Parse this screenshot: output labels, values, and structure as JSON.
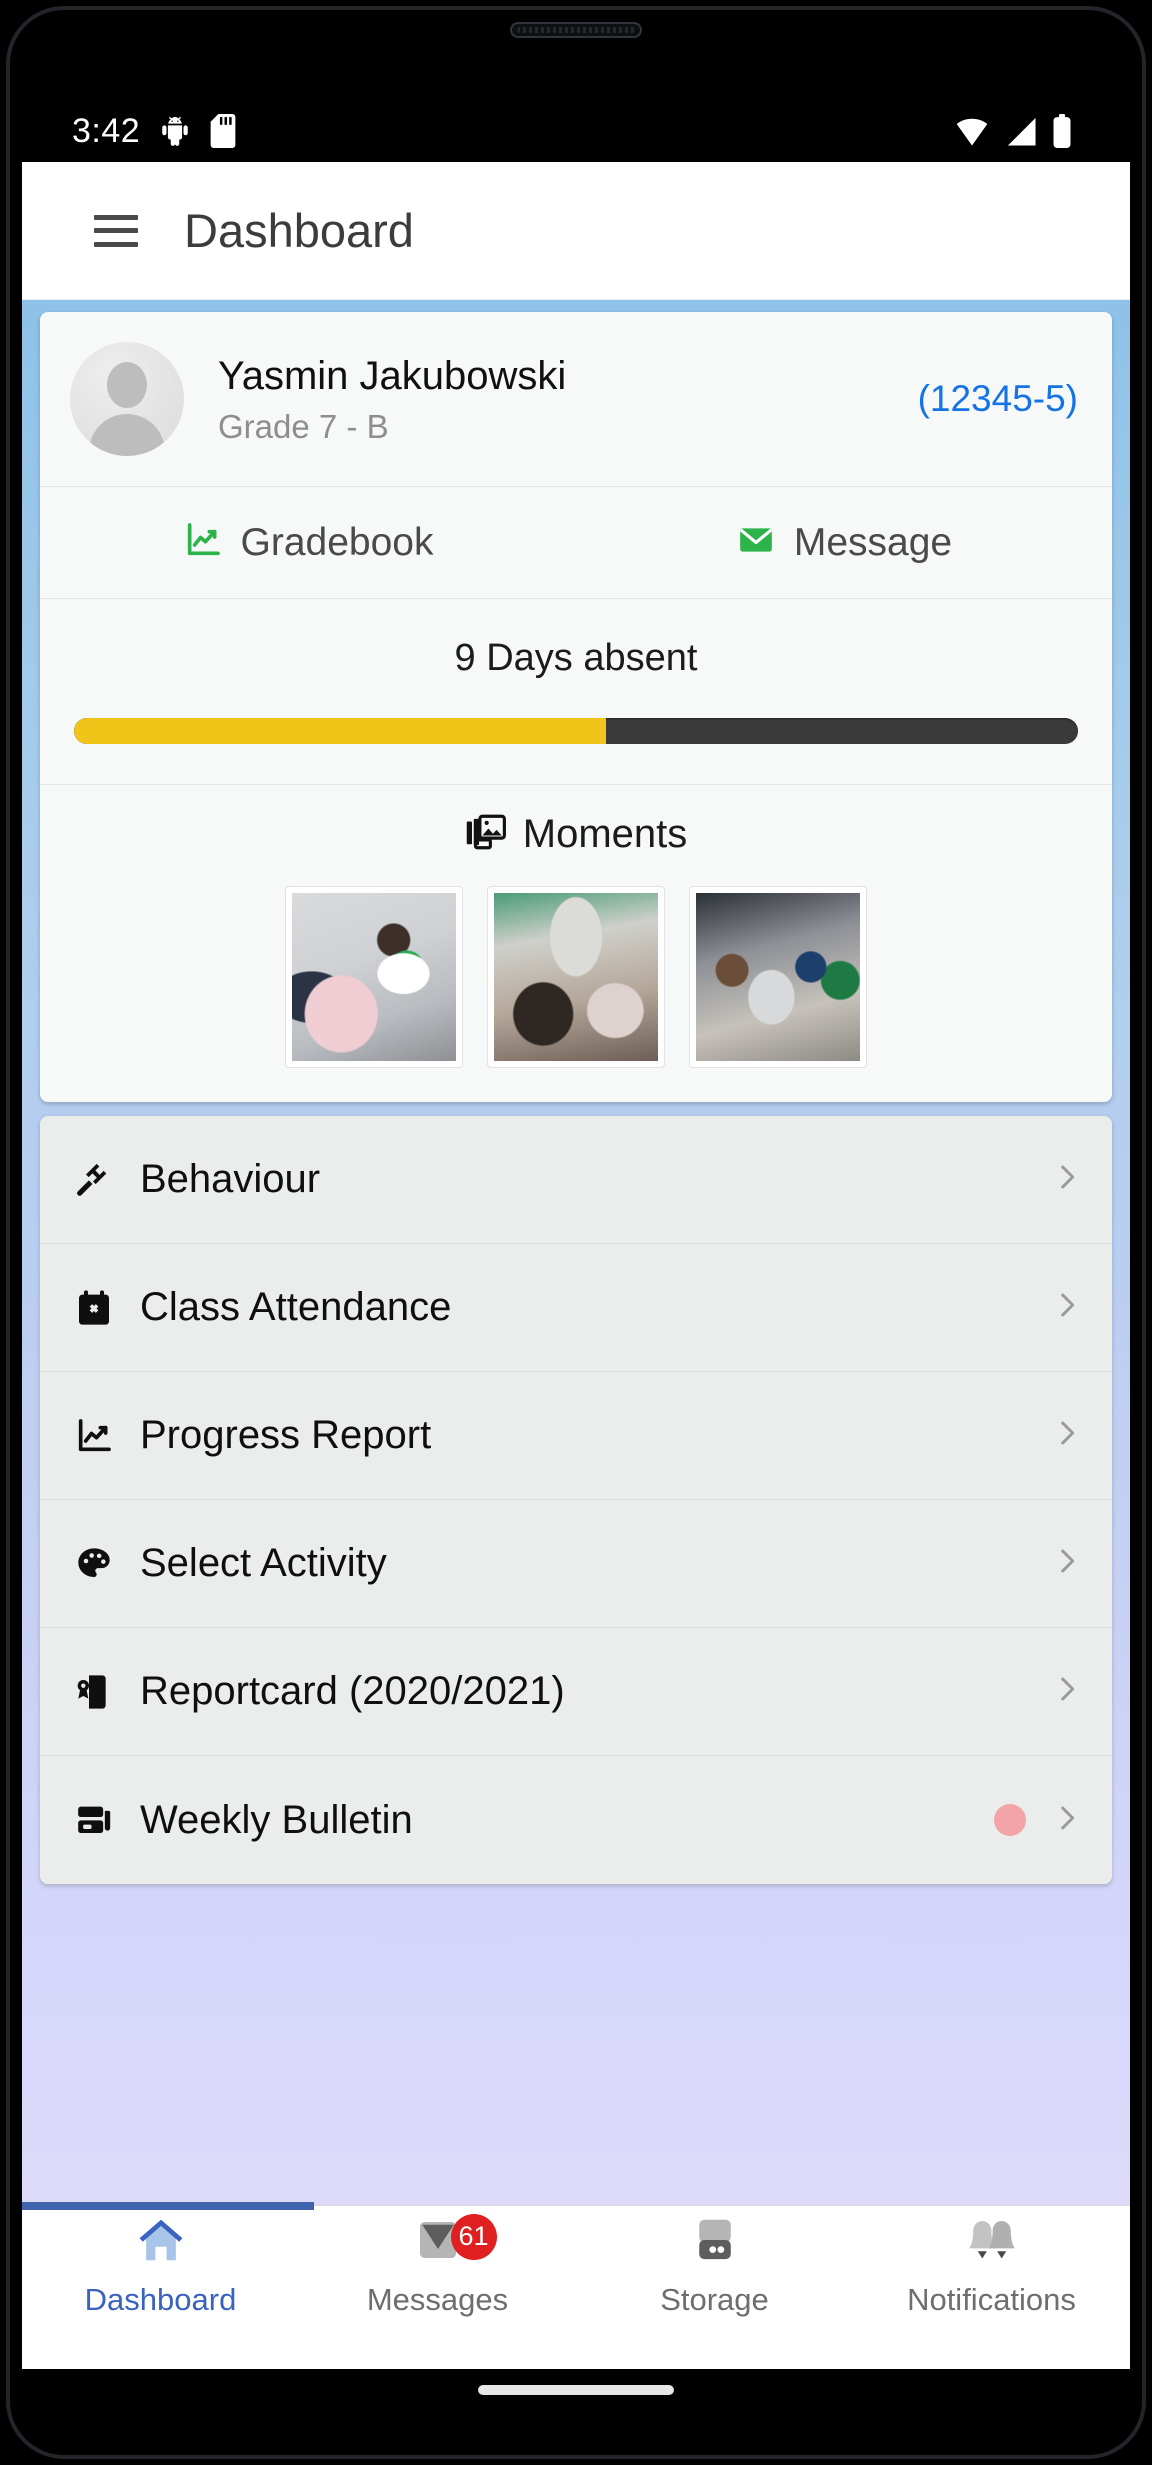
{
  "status_bar": {
    "time": "3:42",
    "icons": [
      "android-debug-icon",
      "sd-card-icon",
      "wifi-icon",
      "signal-icon",
      "battery-icon"
    ]
  },
  "appbar": {
    "menu_icon": "hamburger-menu-icon",
    "title": "Dashboard"
  },
  "student": {
    "name": "Yasmin Jakubowski",
    "grade": "Grade 7 - B",
    "id": "(12345-5)",
    "avatar": "person-placeholder-avatar",
    "id_color": "#1473e6"
  },
  "actions": [
    {
      "label": "Gradebook",
      "icon": "chart-line-icon",
      "color": "#2cb34a"
    },
    {
      "label": "Message",
      "icon": "envelope-icon",
      "color": "#2cb34a"
    }
  ],
  "attendance": {
    "text": "9 Days absent",
    "days_absent": 9,
    "progress_percent": 53,
    "fill_color": "#f0c419",
    "track_color": "#3a3a3a"
  },
  "moments": {
    "title": "Moments",
    "icon": "photo-library-icon",
    "photos": [
      {
        "alt": "classroom students with teacher walking"
      },
      {
        "alt": "classroom lecture from back of room"
      },
      {
        "alt": "students gathered around laptop"
      }
    ]
  },
  "menu_items": [
    {
      "label": "Behaviour",
      "icon": "gavel-icon",
      "has_dot": false
    },
    {
      "label": "Class Attendance",
      "icon": "calendar-x-icon",
      "has_dot": false
    },
    {
      "label": "Progress Report",
      "icon": "chart-line-icon",
      "has_dot": false
    },
    {
      "label": "Select Activity",
      "icon": "palette-icon",
      "has_dot": false
    },
    {
      "label": "Reportcard (2020/2021)",
      "icon": "certificate-document-icon",
      "has_dot": false
    },
    {
      "label": "Weekly Bulletin",
      "icon": "newspaper-icon",
      "has_dot": true,
      "dot_color": "#f2a4a6"
    }
  ],
  "bottom_nav": {
    "active_index": 0,
    "active_color": "#3a63c0",
    "items": [
      {
        "label": "Dashboard",
        "icon": "home-icon",
        "badge": null
      },
      {
        "label": "Messages",
        "icon": "envelope-icon",
        "badge": "61"
      },
      {
        "label": "Storage",
        "icon": "storage-drive-icon",
        "badge": null
      },
      {
        "label": "Notifications",
        "icon": "bells-icon",
        "badge": null
      }
    ]
  }
}
